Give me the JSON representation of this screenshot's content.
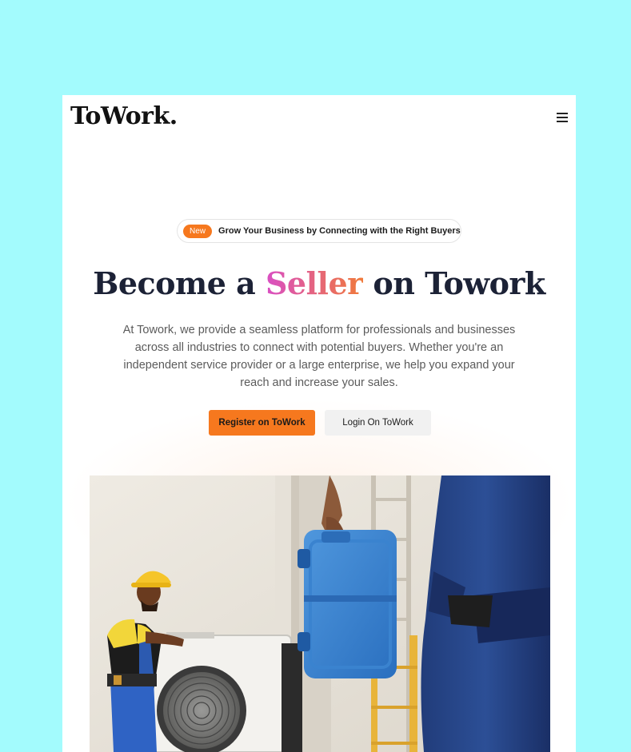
{
  "brand": {
    "logo": "ToWork."
  },
  "nav": {
    "menu_icon": "hamburger-menu-icon"
  },
  "announcement": {
    "badge": "New",
    "text": "Grow Your Business by Connecting with the Right Buyers"
  },
  "hero": {
    "title_pre": "Become a ",
    "title_accent": "Seller",
    "title_post": " on Towork",
    "description": "At Towork, we provide a seamless platform for professionals and businesses across all industries to connect with potential buyers. Whether you're an independent service provider or a large enterprise, we help you expand your reach and increase your sales.",
    "primary_button": "Register on ToWork",
    "secondary_button": "Login On ToWork"
  },
  "colors": {
    "background": "#a3fbfd",
    "accent_orange": "#f6781e",
    "accent_pink": "#d94fc4",
    "heading": "#1c2236"
  }
}
